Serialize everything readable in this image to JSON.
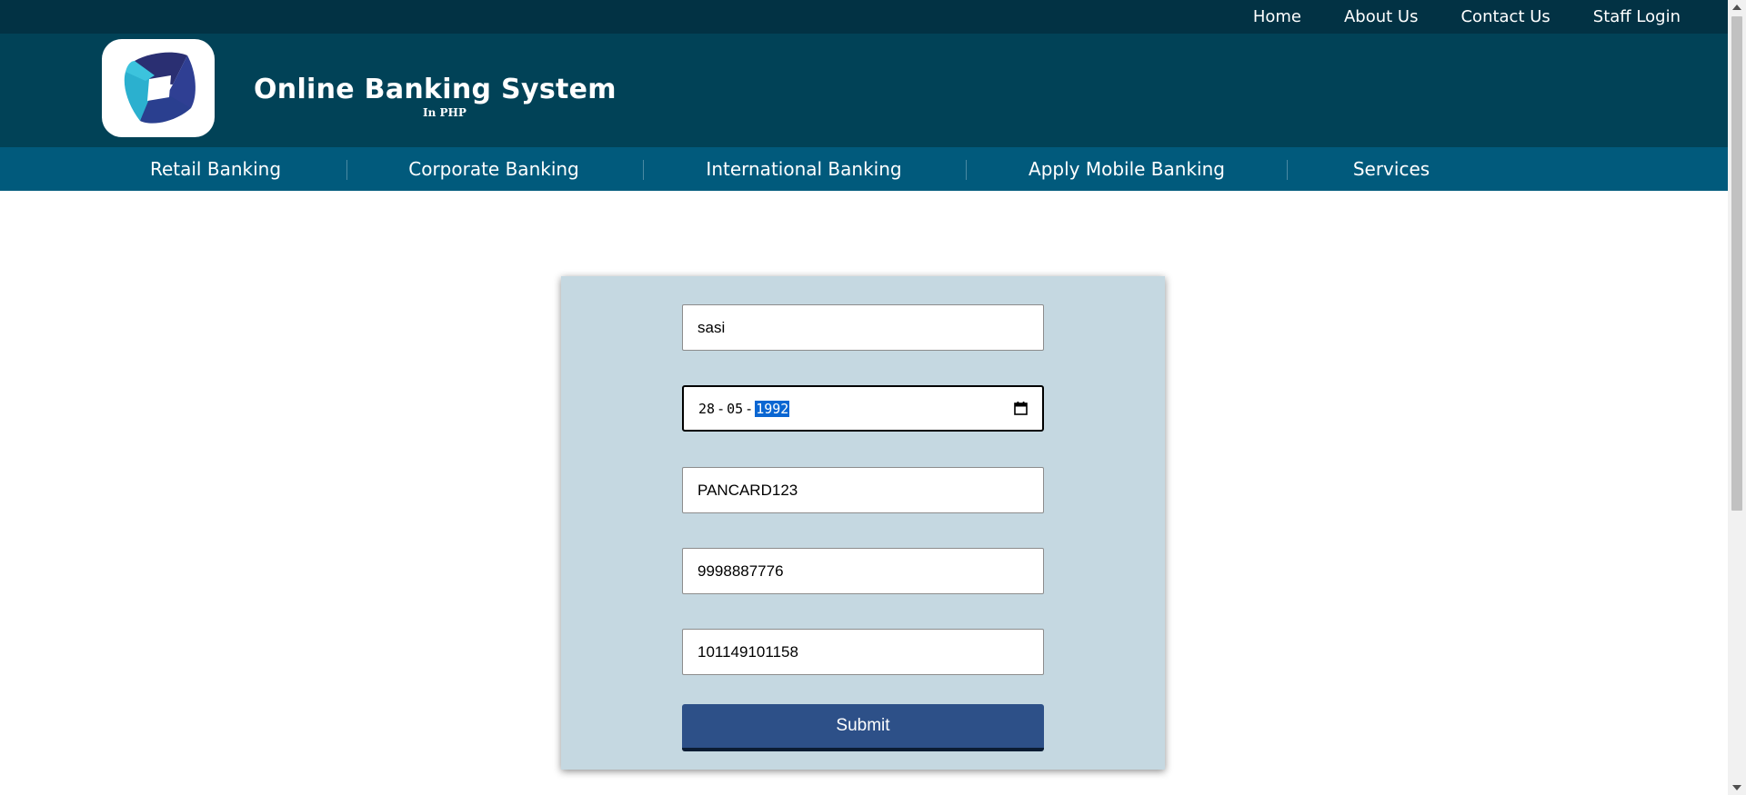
{
  "top_nav": {
    "home": "Home",
    "about": "About Us",
    "contact": "Contact Us",
    "staff_login": "Staff Login"
  },
  "brand": {
    "title": "Online Banking System",
    "subtitle": "In PHP"
  },
  "main_nav": [
    {
      "label": "Retail Banking"
    },
    {
      "label": "Corporate Banking"
    },
    {
      "label": "International Banking"
    },
    {
      "label": "Apply Mobile Banking"
    },
    {
      "label": "Services"
    }
  ],
  "form": {
    "name_value": "sasi",
    "dob": {
      "day": "28",
      "month": "05",
      "year": "1992",
      "separator": "-"
    },
    "pan_value": "PANCARD123",
    "mobile_value": "9998887776",
    "account_value": "101149101158",
    "submit_label": "Submit"
  },
  "colors": {
    "topbar": "#023244",
    "header": "#014257",
    "navbar": "#015a7c",
    "form_bg": "#c5d8e1",
    "submit_bg": "#2d5088",
    "selection": "#0a66d2"
  },
  "icons": {
    "logo": "bank-logo-icon",
    "calendar": "calendar-icon"
  }
}
